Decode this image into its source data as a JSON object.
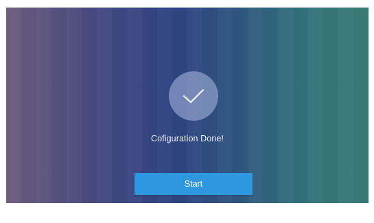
{
  "status": {
    "message": "Cofiguration Done!"
  },
  "actions": {
    "start_label": "Start"
  },
  "icons": {
    "success": "checkmark-icon"
  },
  "colors": {
    "accent": "#2f97e0",
    "gradient_left": "#6e5d7d",
    "gradient_center": "#2e4382",
    "gradient_right": "#3b7b75"
  }
}
